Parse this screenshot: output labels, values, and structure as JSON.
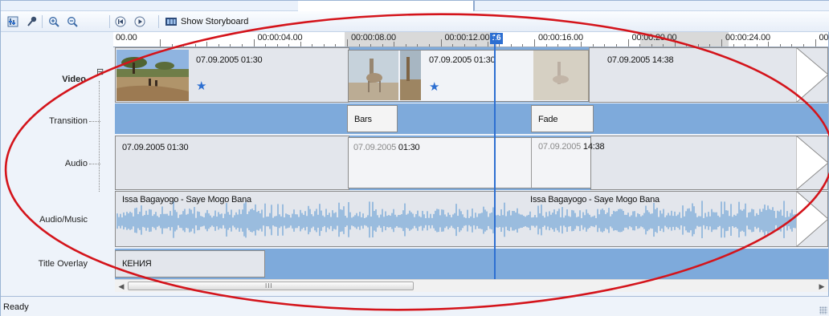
{
  "toolbar": {
    "show_storyboard_label": "Show Storyboard",
    "buttons": [
      "set-audio-levels-icon",
      "narrate-icon",
      "zoom-in-icon",
      "zoom-out-icon",
      "rewind-icon",
      "play-icon",
      "storyboard-icon"
    ]
  },
  "ruler": {
    "ticks": [
      "00.00",
      "00:00:04.00",
      "00:00:08.00",
      "00:00:12.00",
      "00:00:16.00",
      "00:00:20.00",
      "00:00:24.00",
      "00:00:28.00"
    ],
    "ticks_shown": [
      "00.00",
      "00:00:04.00",
      "00:00:08.00",
      "00:00:12.00",
      "00:00:16.00",
      "00:00:20.00",
      "00:00:24.00",
      "00:00:28.00"
    ],
    "playhead_text": "16"
  },
  "tracks": {
    "video": "Video",
    "transition": "Transition",
    "audio": "Audio",
    "audio_music": "Audio/Music",
    "title_overlay": "Title Overlay",
    "collapse_glyph": "⊟"
  },
  "video_clips": [
    {
      "date": "07.09.2005 01:30"
    },
    {
      "date": "07.09.2005 01:30"
    },
    {
      "date": "07.09.2005 14:38"
    }
  ],
  "transitions": [
    {
      "label": "Bars"
    },
    {
      "label": "Fade"
    }
  ],
  "audio_clips": [
    {
      "date": "07.09.2005 01:30"
    },
    {
      "date_faint": "07.09.2005",
      "date_rest": " 01:30"
    },
    {
      "date_faint": "07.09.2005",
      "date_rest": " 14:38"
    }
  ],
  "music_clips": [
    {
      "title": "Issa Bagayogo - Saye Mogo Bana"
    },
    {
      "title": "Issa Bagayogo - Saye Mogo Bana"
    }
  ],
  "title_overlay_clip": {
    "text": "КЕНИЯ"
  },
  "scrollbar": {
    "grip": "III",
    "left_arrow": "◀",
    "right_arrow": "▶"
  },
  "status": {
    "text": "Ready"
  },
  "colors": {
    "track_blue": "#7eaadb",
    "playhead": "#2d6fd1",
    "annotation_red": "#d4141b",
    "waveform": "#7aaad8"
  }
}
